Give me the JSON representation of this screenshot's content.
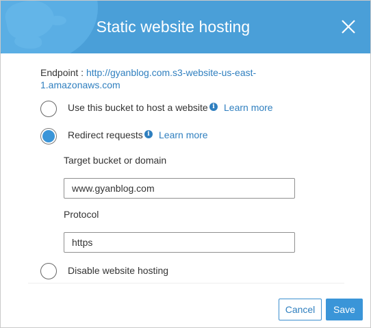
{
  "dialog": {
    "title": "Static website hosting",
    "endpoint_label": "Endpoint :",
    "endpoint_url": "http://gyanblog.com.s3-website-us-east-1.amazonaws.com"
  },
  "options": {
    "host_website": {
      "label": "Use this bucket to host a website",
      "learn_more": "Learn more",
      "selected": false
    },
    "redirect": {
      "label": "Redirect requests",
      "learn_more": "Learn more",
      "selected": true
    },
    "disable": {
      "label": "Disable website hosting",
      "selected": false
    }
  },
  "redirect_fields": {
    "target_label": "Target bucket or domain",
    "target_value": "www.gyanblog.com",
    "protocol_label": "Protocol",
    "protocol_value": "https"
  },
  "buttons": {
    "cancel": "Cancel",
    "save": "Save"
  },
  "icons": {
    "info": "info-icon",
    "close": "close-icon"
  },
  "colors": {
    "header": "#4a9fd8",
    "accent": "#3a95d8",
    "link": "#2f7fbf"
  }
}
